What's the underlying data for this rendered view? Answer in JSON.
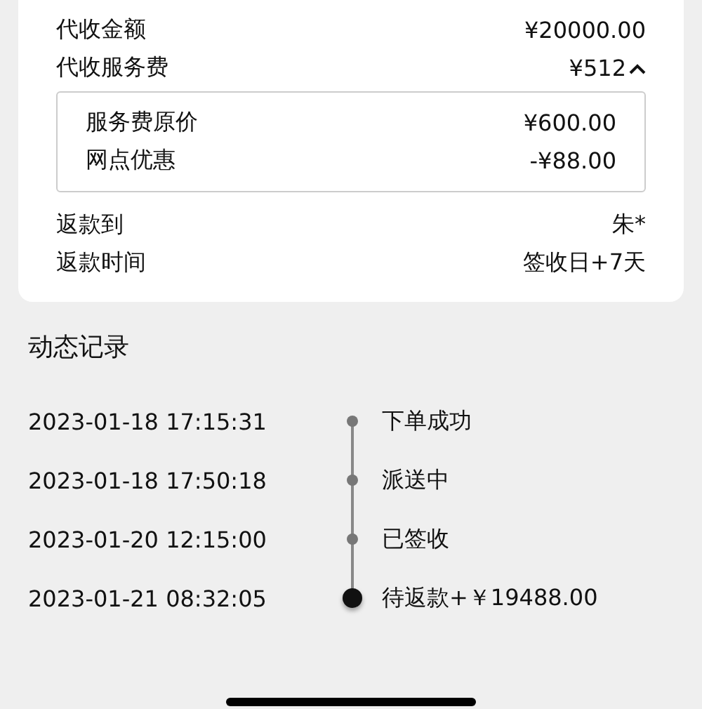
{
  "summary": {
    "rows": [
      {
        "label": "代收金额",
        "value": "¥20000.00"
      },
      {
        "label": "代收服务费",
        "value": "¥512",
        "expanded": true,
        "details": [
          {
            "label": "服务费原价",
            "value": "¥600.00"
          },
          {
            "label": "网点优惠",
            "value": "-¥88.00"
          }
        ]
      },
      {
        "label": "返款到",
        "value": "朱*"
      },
      {
        "label": "返款时间",
        "value": "签收日+7天"
      }
    ]
  },
  "timeline": {
    "title": "动态记录",
    "events": [
      {
        "time": "2023-01-18 17:15:31",
        "status": "下单成功",
        "current": false
      },
      {
        "time": "2023-01-18 17:50:18",
        "status": "派送中",
        "current": false
      },
      {
        "time": "2023-01-20 12:15:00",
        "status": "已签收",
        "current": false
      },
      {
        "time": "2023-01-21 08:32:05",
        "status": "待返款+￥19488.00",
        "current": true
      }
    ]
  }
}
